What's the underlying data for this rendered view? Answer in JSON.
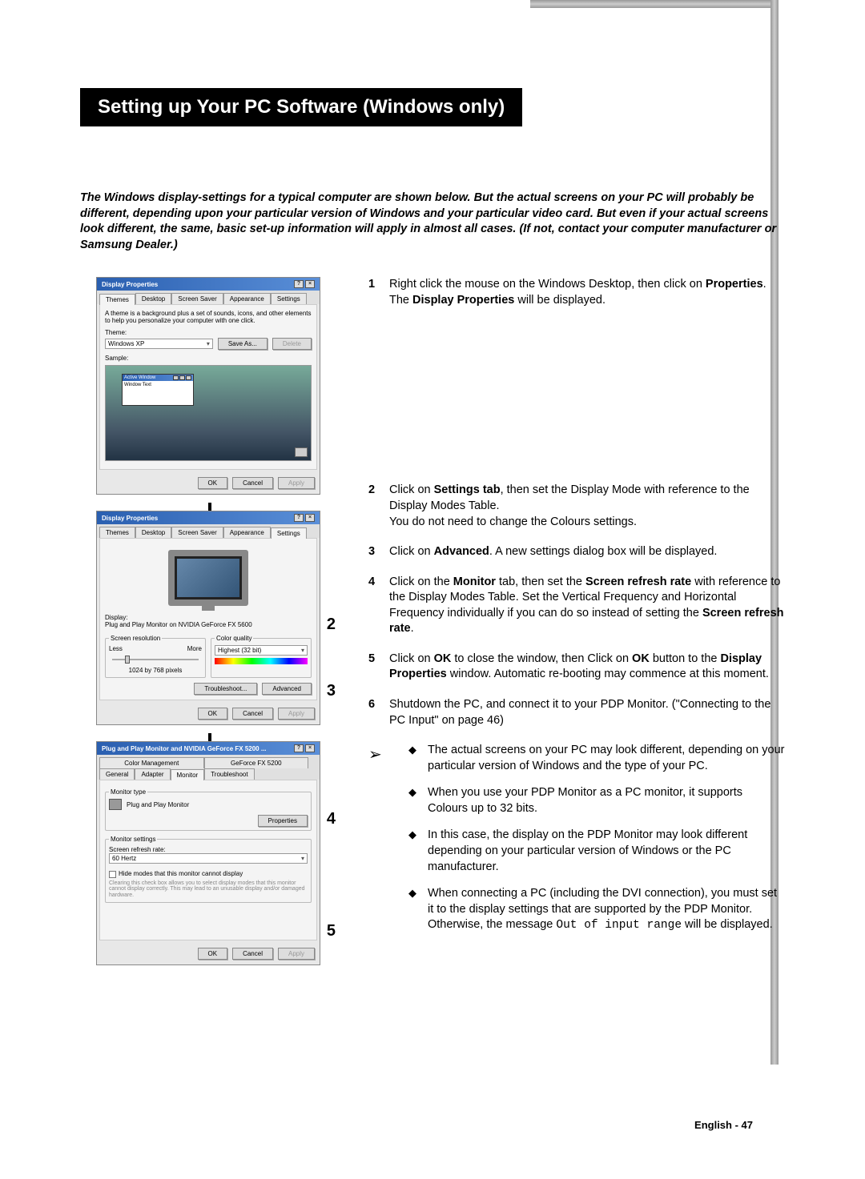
{
  "title": "Setting up Your PC Software (Windows only)",
  "intro": "The Windows display-settings for a typical computer are shown below. But the actual screens on your PC will probably be different, depending upon your particular version of Windows and your particular video card. But even if your actual screens look different, the same, basic set-up information will apply in almost all cases. (If not, contact your computer manufacturer or Samsung Dealer.)",
  "dlg1": {
    "title": "Display Properties",
    "help": "?",
    "close": "×",
    "tabs": {
      "themes": "Themes",
      "desktop": "Desktop",
      "ss": "Screen Saver",
      "app": "Appearance",
      "set": "Settings"
    },
    "desc": "A theme is a background plus a set of sounds, icons, and other elements to help you personalize your computer with one click.",
    "theme_label": "Theme:",
    "theme_value": "Windows XP",
    "saveas": "Save As...",
    "delete": "Delete",
    "sample": "Sample:",
    "active": "Active Window",
    "wintext": "Window Text",
    "ok": "OK",
    "cancel": "Cancel",
    "apply": "Apply"
  },
  "dlg2": {
    "title": "Display Properties",
    "display_label": "Display:",
    "display_value": "Plug and Play Monitor on NVIDIA GeForce FX 5600",
    "sr": "Screen resolution",
    "less": "Less",
    "more": "More",
    "res": "1024 by 768 pixels",
    "cq": "Color quality",
    "cq_value": "Highest (32 bit)",
    "troubleshoot": "Troubleshoot...",
    "advanced": "Advanced",
    "ok": "OK",
    "cancel": "Cancel",
    "apply": "Apply"
  },
  "dlg3": {
    "title": "Plug and Play Monitor and NVIDIA GeForce FX 5200 ...",
    "tabs": {
      "cm": "Color Management",
      "gf": "GeForce FX 5200",
      "gen": "General",
      "ad": "Adapter",
      "mon": "Monitor",
      "tr": "Troubleshoot"
    },
    "mtype": "Monitor type",
    "mname": "Plug and Play Monitor",
    "props": "Properties",
    "mset": "Monitor settings",
    "srr": "Screen refresh rate:",
    "srr_value": "60 Hertz",
    "hide": "Hide modes that this monitor cannot display",
    "hide_desc": "Clearing this check box allows you to select display modes that this monitor cannot display correctly. This may lead to an unusable display and/or damaged hardware.",
    "ok": "OK",
    "cancel": "Cancel",
    "apply": "Apply"
  },
  "markers": {
    "m2": "2",
    "m3": "3",
    "m4": "4",
    "m5": "5"
  },
  "steps": {
    "s1n": "1",
    "s1a": "Right click the mouse on the Windows Desktop, then click on ",
    "s1b": "Properties",
    "s1c": ".",
    "s1d": "The ",
    "s1e": "Display Properties",
    "s1f": " will be displayed.",
    "s2n": "2",
    "s2a": "Click on ",
    "s2b": "Settings tab",
    "s2c": ", then set the Display Mode with reference to the Display Modes Table.",
    "s2d": "You do not need to change the Colours settings.",
    "s3n": "3",
    "s3a": "Click on ",
    "s3b": "Advanced",
    "s3c": ". A new settings dialog box will be displayed.",
    "s4n": "4",
    "s4a": "Click on the ",
    "s4b": "Monitor",
    "s4c": " tab, then set the ",
    "s4d": "Screen refresh rate",
    "s4e": " with reference to the Display Modes Table. Set the Vertical Frequency and Horizontal Frequency individually if you can do so instead of setting the ",
    "s4f": "Screen refresh rate",
    "s4g": ".",
    "s5n": "5",
    "s5a": "Click on ",
    "s5b": "OK",
    "s5c": " to close the window, then Click on ",
    "s5d": "OK",
    "s5e": " button to the ",
    "s5f": "Display Properties",
    "s5g": " window. Automatic re-booting may commence at this moment.",
    "s6n": "6",
    "s6a": "Shutdown the PC, and connect it to your PDP Monitor. (\"Connecting to the PC Input\" on page 46)"
  },
  "notes": {
    "n1": "The actual screens on your PC may look different, depending on your particular version of Windows and the type of your PC.",
    "n2": "When you use your PDP Monitor as a PC monitor, it supports Colours up to 32 bits.",
    "n3": "In this case, the display on the PDP Monitor may look different depending on your particular version of Windows or the PC manufacturer.",
    "n4a": "When connecting a PC (including the DVI connection), you must set it to the display settings that are supported by the PDP Monitor. Otherwise, the message ",
    "n4b": "Out of input range",
    "n4c": " will be displayed."
  },
  "footer": "English - 47"
}
